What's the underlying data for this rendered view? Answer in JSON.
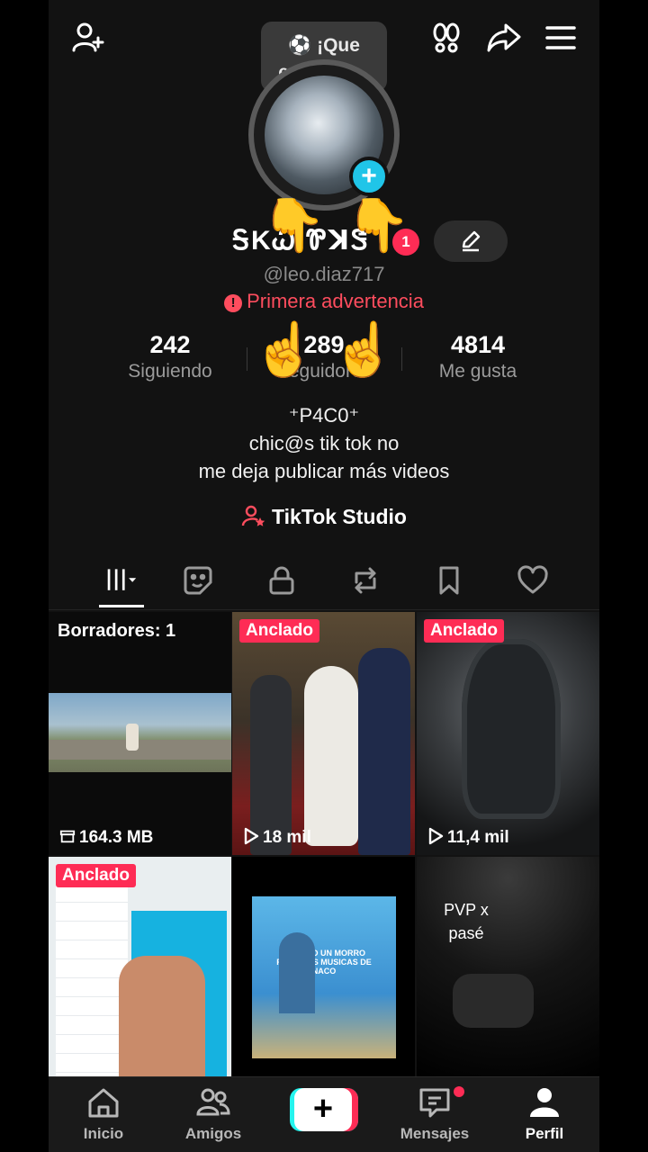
{
  "header": {
    "story_bubble": "¡Que empiece...",
    "icons": [
      "add-friend-icon",
      "footprints-icon",
      "share-icon",
      "menu-icon"
    ]
  },
  "profile": {
    "display_name": "ᎦKᏇ ᏈꓘᏕ",
    "notification_count": "1",
    "username": "@leo.diaz717",
    "warning": "Primera advertencia",
    "stats": [
      {
        "value": "242",
        "label": "Siguiendo"
      },
      {
        "value": "289",
        "label": "Seguidores"
      },
      {
        "value": "4814",
        "label": "Me gusta"
      }
    ],
    "bio_line1": "⁺P4C0⁺",
    "bio_line2": "chic@s tik tok no",
    "bio_line3": "me deja publicar más videos",
    "studio_label": "TikTok Studio"
  },
  "tabs": [
    "videos",
    "reposts-sticker",
    "private",
    "reposts",
    "saved",
    "liked"
  ],
  "grid": [
    {
      "label": "Borradores: 1",
      "meta": "164.3 MB"
    },
    {
      "label": "Anclado",
      "meta": "18 mil"
    },
    {
      "label": "Anclado",
      "meta": "11,4 mil"
    },
    {
      "label": "Anclado",
      "meta": ""
    },
    {
      "label": "",
      "caption": "CUANDO UN MORRO PONE SUS MUSICAS DE NACO",
      "meta": ""
    },
    {
      "label": "",
      "overlay": "PVP x pasé",
      "meta": ""
    }
  ],
  "nav": {
    "home": "Inicio",
    "friends": "Amigos",
    "messages": "Mensajes",
    "profile": "Perfil"
  },
  "colors": {
    "accent": "#fe2c55",
    "cyan": "#25f4ee",
    "background": "#121212"
  }
}
